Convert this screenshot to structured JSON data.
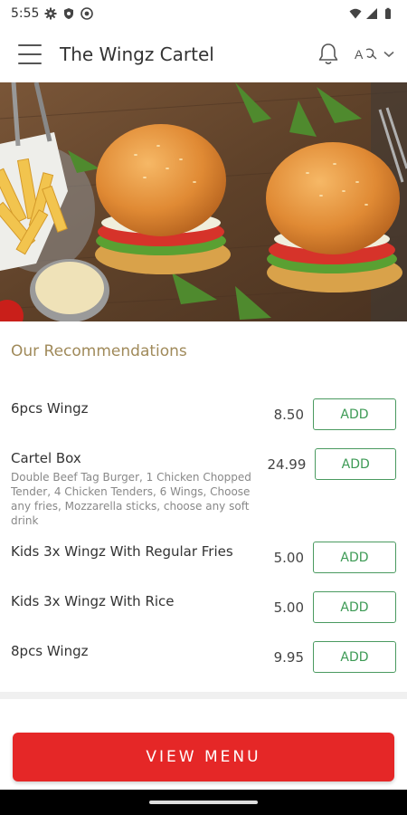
{
  "status_bar": {
    "time": "5:55",
    "left_icons": [
      "gear-icon",
      "shield-icon",
      "settings-badge-icon"
    ],
    "right_icons": [
      "wifi-icon",
      "signal-icon",
      "battery-icon"
    ]
  },
  "app_bar": {
    "title": "The Wingz Cartel",
    "menu_icon": "hamburger-menu-icon",
    "bell_icon": "bell-icon",
    "lang_icon": "language-icon",
    "chevron_icon": "chevron-down-icon"
  },
  "recommendations": {
    "title": "Our Recommendations",
    "items": [
      {
        "name": "6pcs Wingz",
        "description": "",
        "price": "8.50",
        "add_label": "ADD"
      },
      {
        "name": "Cartel Box",
        "description": "Double Beef Tag Burger, 1 Chicken Chopped Tender, 4 Chicken Tenders, 6 Wings, Choose any fries, Mozzarella sticks, choose any soft drink",
        "price": "24.99",
        "add_label": "ADD"
      },
      {
        "name": "Kids 3x Wingz With Regular Fries",
        "description": "",
        "price": "5.00",
        "add_label": "ADD"
      },
      {
        "name": "Kids 3x Wingz With Rice",
        "description": "",
        "price": "5.00",
        "add_label": "ADD"
      },
      {
        "name": "8pcs Wingz",
        "description": "",
        "price": "9.95",
        "add_label": "ADD"
      }
    ]
  },
  "cta": {
    "view_menu_label": "VIEW MENU"
  },
  "colors": {
    "accent_red": "#e52727",
    "add_green": "#3d9a55",
    "section_title": "#a08a5a"
  }
}
